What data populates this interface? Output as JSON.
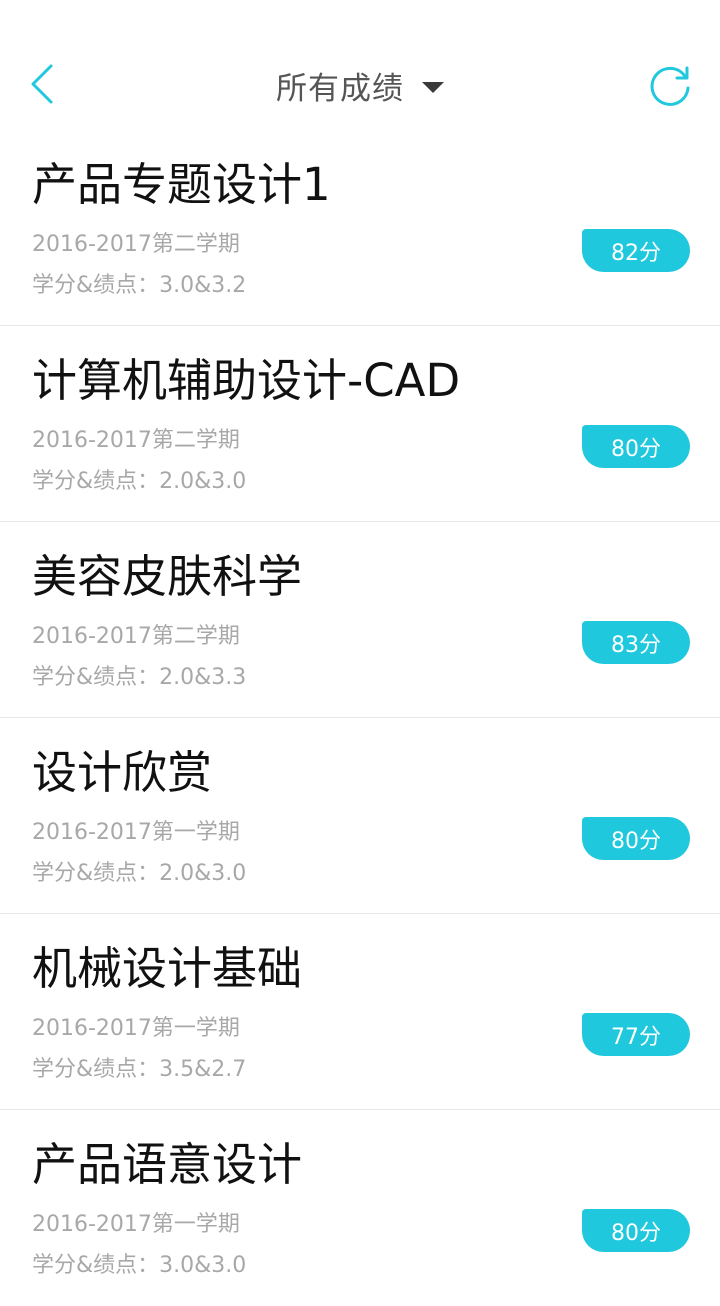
{
  "header": {
    "title": "所有成绩"
  },
  "courses": [
    {
      "name": "产品专题设计1",
      "term": "2016-2017第二学期",
      "credit": "学分&绩点：3.0&3.2",
      "score": "82分"
    },
    {
      "name": "计算机辅助设计-CAD",
      "term": "2016-2017第二学期",
      "credit": "学分&绩点：2.0&3.0",
      "score": "80分"
    },
    {
      "name": "美容皮肤科学",
      "term": "2016-2017第二学期",
      "credit": "学分&绩点：2.0&3.3",
      "score": "83分"
    },
    {
      "name": "设计欣赏",
      "term": "2016-2017第一学期",
      "credit": "学分&绩点：2.0&3.0",
      "score": "80分"
    },
    {
      "name": "机械设计基础",
      "term": "2016-2017第一学期",
      "credit": "学分&绩点：3.5&2.7",
      "score": "77分"
    },
    {
      "name": "产品语意设计",
      "term": "2016-2017第一学期",
      "credit": "学分&绩点：3.0&3.0",
      "score": "80分"
    }
  ]
}
